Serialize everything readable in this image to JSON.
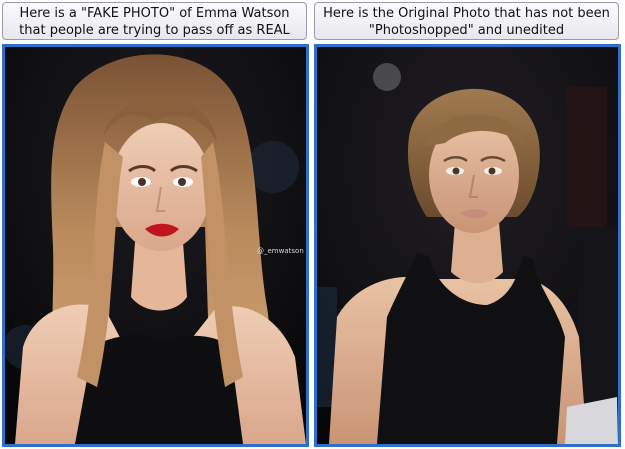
{
  "panels": [
    {
      "caption": "Here is a \"FAKE PHOTO\" of Emma Watson that people are trying to pass off as REAL",
      "photo_label": "Emma Watson, edited photo: long wavy light-brown hair, red lipstick, black sleeveless top, dark background",
      "watermark": "@_emwatson"
    },
    {
      "caption": "Here is the Original Photo that has not been \"Photoshopped\" and unedited",
      "photo_label": "Emma Watson, original photo: hair pulled back, black halter-neck top, seated at an event, dark background"
    }
  ],
  "colors": {
    "frame_border": "#2f6fc7",
    "caption_border": "#9a9aa6",
    "photo_background": "#0b0b0d"
  }
}
